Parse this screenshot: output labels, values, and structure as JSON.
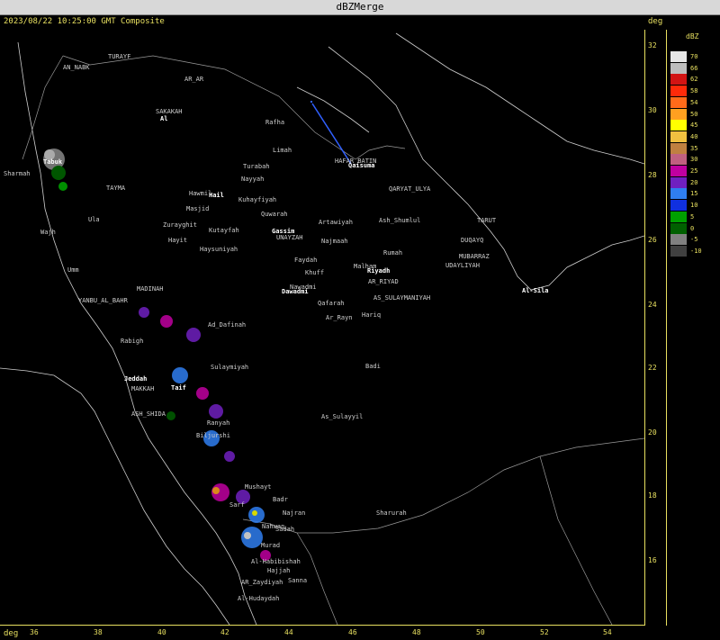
{
  "window": {
    "title": "dBZMerge"
  },
  "header": {
    "timestamp": "2023/08/22 10:25:00 GMT Composite",
    "unit_top": "deg",
    "unit_bottom": "deg"
  },
  "axes": {
    "latitudes": [
      "32",
      "30",
      "28",
      "26",
      "24",
      "22",
      "20",
      "18",
      "16"
    ],
    "longitudes": [
      "36",
      "38",
      "40",
      "42",
      "44",
      "46",
      "48",
      "50",
      "52",
      "54"
    ]
  },
  "legend": {
    "title": "dBZ",
    "levels": [
      {
        "label": "70",
        "color": "#e6e6e6"
      },
      {
        "label": "66",
        "color": "#bdbdbd"
      },
      {
        "label": "62",
        "color": "#d21414"
      },
      {
        "label": "58",
        "color": "#ff2a0a"
      },
      {
        "label": "54",
        "color": "#ff6a1a"
      },
      {
        "label": "50",
        "color": "#ffa020"
      },
      {
        "label": "45",
        "color": "#ffff00"
      },
      {
        "label": "40",
        "color": "#f0c040"
      },
      {
        "label": "35",
        "color": "#c08040"
      },
      {
        "label": "30",
        "color": "#c06080"
      },
      {
        "label": "25",
        "color": "#c000a0"
      },
      {
        "label": "20",
        "color": "#7020c0"
      },
      {
        "label": "15",
        "color": "#2f7ef0"
      },
      {
        "label": "10",
        "color": "#1030e0"
      },
      {
        "label": "5",
        "color": "#00a000"
      },
      {
        "label": "0",
        "color": "#006000"
      },
      {
        "label": "-5",
        "color": "#808080"
      },
      {
        "label": "-10",
        "color": "#404040"
      }
    ]
  },
  "cities": [
    {
      "name": "TURAYF"
    },
    {
      "name": "AN_NABK"
    },
    {
      "name": "AR_AR"
    },
    {
      "name": "SAKAKAH"
    },
    {
      "name": "Al"
    },
    {
      "name": "Rafha"
    },
    {
      "name": "Limah"
    },
    {
      "name": "HAFAR_BATIN"
    },
    {
      "name": "Qaisuma"
    },
    {
      "name": "Turabah"
    },
    {
      "name": "Nayyah"
    },
    {
      "name": "Tabuk"
    },
    {
      "name": "Sharmah"
    },
    {
      "name": "TAYMA"
    },
    {
      "name": "Hawmil"
    },
    {
      "name": "Hail"
    },
    {
      "name": "Kuhayfiyah"
    },
    {
      "name": "QARYAT_ULYA"
    },
    {
      "name": "Masjid"
    },
    {
      "name": "Quwarah"
    },
    {
      "name": "Artawiyah"
    },
    {
      "name": "Ash_Shumlul"
    },
    {
      "name": "TARUT"
    },
    {
      "name": "Ula"
    },
    {
      "name": "Wajh"
    },
    {
      "name": "Zurayghit"
    },
    {
      "name": "Kutayfah"
    },
    {
      "name": "Gassim"
    },
    {
      "name": "UNAYZAH"
    },
    {
      "name": "Hayit"
    },
    {
      "name": "Najmaah"
    },
    {
      "name": "DUQAYQ"
    },
    {
      "name": "Haysuniyah"
    },
    {
      "name": "Rumah"
    },
    {
      "name": "MUBARRAZ"
    },
    {
      "name": "Faydah"
    },
    {
      "name": "Malham"
    },
    {
      "name": "Riyadh"
    },
    {
      "name": "UDAYLIYAH"
    },
    {
      "name": "Umm"
    },
    {
      "name": "Khuff"
    },
    {
      "name": "AR_RIYAD"
    },
    {
      "name": "Al-Sila"
    },
    {
      "name": "Nawadmi"
    },
    {
      "name": "MADINAH"
    },
    {
      "name": "Dawadmi"
    },
    {
      "name": "YANBU_AL_BAHR"
    },
    {
      "name": "Qafarah"
    },
    {
      "name": "AS_SULAYMANIYAH"
    },
    {
      "name": "Hariq"
    },
    {
      "name": "Ad_Dafinah"
    },
    {
      "name": "Ar_Rayn"
    },
    {
      "name": "Rabigh"
    },
    {
      "name": "Sulaymiyah"
    },
    {
      "name": "Badi"
    },
    {
      "name": "Jeddah"
    },
    {
      "name": "MAKKAH"
    },
    {
      "name": "Taif"
    },
    {
      "name": "ASH_SHIDA"
    },
    {
      "name": "As_Sulayyil"
    },
    {
      "name": "Ranyah"
    },
    {
      "name": "Biljurshi"
    },
    {
      "name": "Mushayt"
    },
    {
      "name": "Badr"
    },
    {
      "name": "Sarf"
    },
    {
      "name": "Najran"
    },
    {
      "name": "Sharurah"
    },
    {
      "name": "Nahwan"
    },
    {
      "name": "Sadah"
    },
    {
      "name": "Murad"
    },
    {
      "name": "Al-Habibishah"
    },
    {
      "name": "Hajjah"
    },
    {
      "name": "Sanna"
    },
    {
      "name": "AR_Zaydiyah"
    },
    {
      "name": "Al-Hudaydah"
    }
  ]
}
